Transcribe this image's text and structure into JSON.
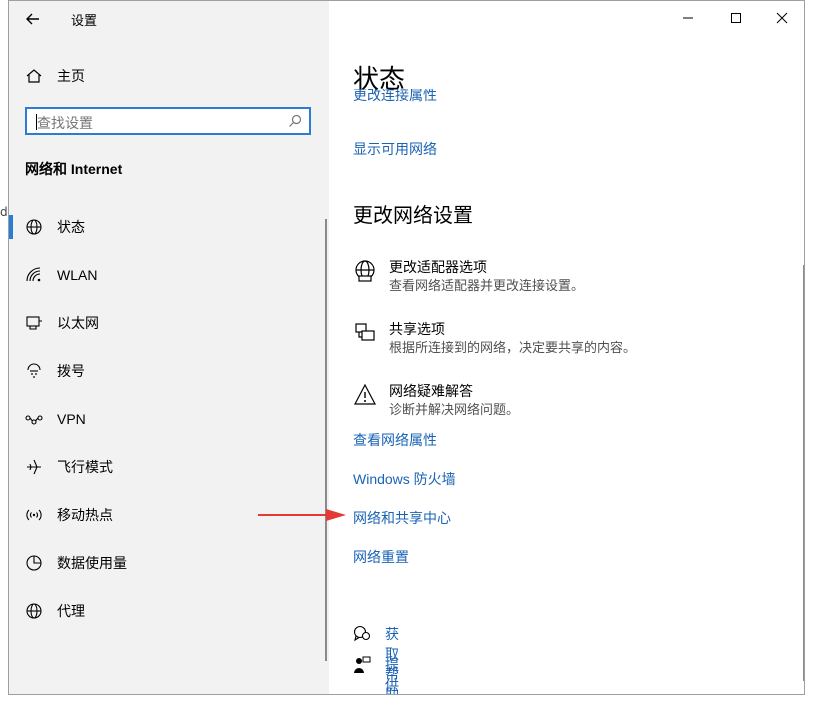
{
  "window": {
    "title": "设置"
  },
  "sidebar": {
    "home_label": "主页",
    "search_placeholder": "查找设置",
    "section_title": "网络和 Internet",
    "items": [
      {
        "label": "状态",
        "icon": "globe-icon",
        "active": true
      },
      {
        "label": "WLAN",
        "icon": "wifi-icon"
      },
      {
        "label": "以太网",
        "icon": "ethernet-icon"
      },
      {
        "label": "拨号",
        "icon": "dialup-icon"
      },
      {
        "label": "VPN",
        "icon": "vpn-icon"
      },
      {
        "label": "飞行模式",
        "icon": "airplane-icon"
      },
      {
        "label": "移动热点",
        "icon": "hotspot-icon"
      },
      {
        "label": "数据使用量",
        "icon": "data-usage-icon"
      },
      {
        "label": "代理",
        "icon": "proxy-globe-icon"
      }
    ]
  },
  "main": {
    "page_title": "状态",
    "clipped_link": "更改连接属性",
    "show_networks_link": "显示可用网络",
    "change_settings_heading": "更改网络设置",
    "options": [
      {
        "title": "更改适配器选项",
        "desc": "查看网络适配器并更改连接设置。",
        "icon": "adapter-globe-icon"
      },
      {
        "title": "共享选项",
        "desc": "根据所连接到的网络，决定要共享的内容。",
        "icon": "sharing-icon"
      },
      {
        "title": "网络疑难解答",
        "desc": "诊断并解决网络问题。",
        "icon": "warning-icon"
      }
    ],
    "links": [
      "查看网络属性",
      "Windows 防火墙",
      "网络和共享中心",
      "网络重置"
    ],
    "help": {
      "get_help": "获取帮助",
      "feedback": "提供反馈"
    }
  },
  "colors": {
    "accent": "#2b7cd3",
    "link": "#1a63b5",
    "sidebar_bg": "#f2f2f2",
    "arrow": "#e53935"
  }
}
